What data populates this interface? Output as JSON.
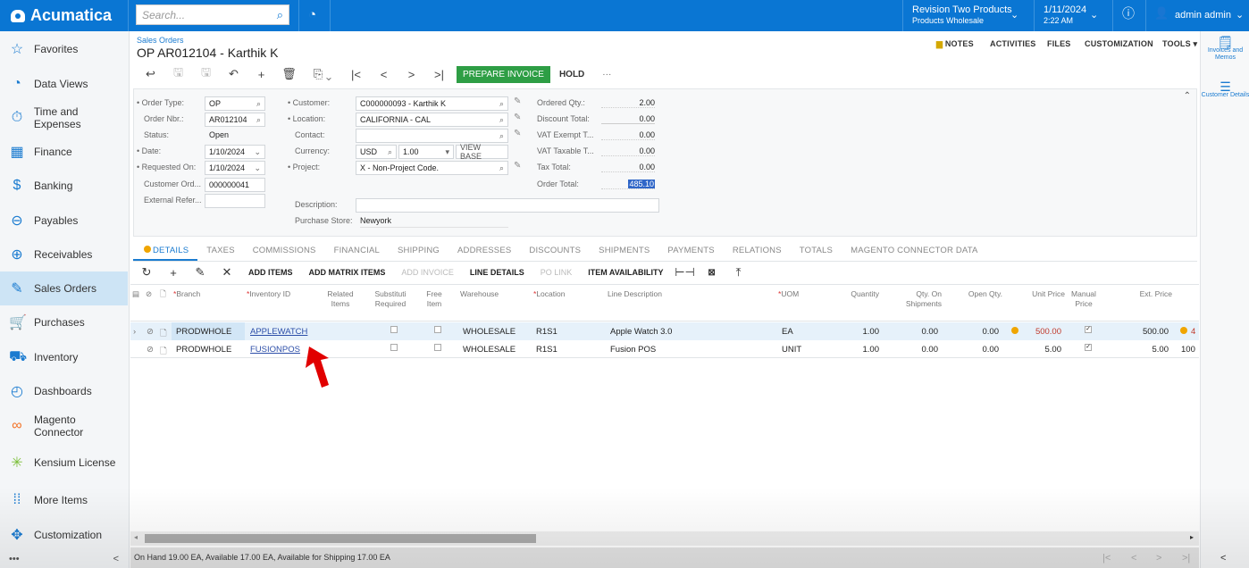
{
  "topbar": {
    "brand": "Acumatica",
    "search_placeholder": "Search...",
    "company": "Revision Two Products",
    "branch": "Products Wholesale",
    "date": "1/11/2024",
    "time": "2:22 AM",
    "user": "admin admin"
  },
  "sidebar": {
    "items": [
      {
        "label": "Favorites",
        "icon": "star-icon"
      },
      {
        "label": "Data Views",
        "icon": "pie-chart-icon"
      },
      {
        "label": "Time and Expenses",
        "icon": "stopwatch-icon"
      },
      {
        "label": "Finance",
        "icon": "calculator-icon"
      },
      {
        "label": "Banking",
        "icon": "dollar-icon"
      },
      {
        "label": "Payables",
        "icon": "minus-circle-icon"
      },
      {
        "label": "Receivables",
        "icon": "plus-circle-icon"
      },
      {
        "label": "Sales Orders",
        "icon": "edit-icon",
        "active": true
      },
      {
        "label": "Purchases",
        "icon": "cart-icon"
      },
      {
        "label": "Inventory",
        "icon": "truck-icon"
      },
      {
        "label": "Dashboards",
        "icon": "gauge-icon"
      },
      {
        "label": "Magento Connector",
        "icon": "magento-icon"
      },
      {
        "label": "Kensium License",
        "icon": "kensium-icon"
      },
      {
        "label": "More Items",
        "icon": "grid-dots-icon"
      },
      {
        "label": "Customization",
        "icon": "puzzle-icon"
      }
    ],
    "more": "•••",
    "collapse": "<"
  },
  "page": {
    "breadcrumb": "Sales Orders",
    "title": "OP AR012104 - Karthik K",
    "actions": [
      "NOTES",
      "ACTIVITIES",
      "FILES",
      "CUSTOMIZATION",
      "TOOLS ▾"
    ],
    "prepare_invoice": "PREPARE INVOICE",
    "hold": "HOLD",
    "more": "···"
  },
  "form": {
    "order_type_label": "Order Type:",
    "order_type": "OP",
    "order_nbr_label": "Order Nbr.:",
    "order_nbr": "AR012104",
    "status_label": "Status:",
    "status": "Open",
    "date_label": "Date:",
    "date": "1/10/2024",
    "requested_on_label": "Requested On:",
    "requested_on": "1/10/2024",
    "customer_ord_label": "Customer Ord...",
    "customer_ord": "000000041",
    "external_ref_label": "External Refer...",
    "external_ref": "",
    "customer_label": "Customer:",
    "customer": "C000000093 - Karthik K",
    "location_label": "Location:",
    "location": "CALIFORNIA - CAL",
    "contact_label": "Contact:",
    "contact": "",
    "currency_label": "Currency:",
    "currency": "USD",
    "rate": "1.00",
    "view_base": "VIEW BASE",
    "project_label": "Project:",
    "project": "X - Non-Project Code.",
    "description_label": "Description:",
    "description": "",
    "purchase_store_label": "Purchase Store:",
    "purchase_store": "Newyork",
    "ordered_qty_label": "Ordered Qty.:",
    "ordered_qty": "2.00",
    "discount_total_label": "Discount Total:",
    "discount_total": "0.00",
    "vat_exempt_label": "VAT Exempt T...",
    "vat_exempt": "0.00",
    "vat_taxable_label": "VAT Taxable T...",
    "vat_taxable": "0.00",
    "tax_total_label": "Tax Total:",
    "tax_total": "0.00",
    "order_total_label": "Order Total:",
    "order_total": "485.10"
  },
  "tabs": [
    "DETAILS",
    "TAXES",
    "COMMISSIONS",
    "FINANCIAL",
    "SHIPPING",
    "ADDRESSES",
    "DISCOUNTS",
    "SHIPMENTS",
    "PAYMENTS",
    "RELATIONS",
    "TOTALS",
    "MAGENTO CONNECTOR DATA"
  ],
  "grid_toolbar": {
    "add_items": "ADD ITEMS",
    "add_matrix_items": "ADD MATRIX ITEMS",
    "add_invoice": "ADD INVOICE",
    "line_details": "LINE DETAILS",
    "po_link": "PO LINK",
    "item_availability": "ITEM AVAILABILITY"
  },
  "grid": {
    "headers": {
      "branch": "Branch",
      "inventory_id": "Inventory ID",
      "related_items": "Related Items",
      "substitute": "Substituti Required",
      "free_item": "Free Item",
      "warehouse": "Warehouse",
      "location": "Location",
      "line_description": "Line Description",
      "uom": "UOM",
      "quantity": "Quantity",
      "qty_on_shipments": "Qty. On Shipments",
      "open_qty": "Open Qty.",
      "unit_price": "Unit Price",
      "manual_price": "Manual Price",
      "ext_price": "Ext. Price"
    },
    "rows": [
      {
        "branch": "PRODWHOLE",
        "inventory_id": "APPLEWATCH",
        "warehouse": "WHOLESALE",
        "location": "R1S1",
        "description": "Apple Watch 3.0",
        "uom": "EA",
        "quantity": "1.00",
        "qty_on_shipments": "0.00",
        "open_qty": "0.00",
        "unit_price": "500.00",
        "ext_price": "500.00",
        "extra": "4"
      },
      {
        "branch": "PRODWHOLE",
        "inventory_id": "FUSIONPOS",
        "warehouse": "WHOLESALE",
        "location": "R1S1",
        "description": "Fusion POS",
        "uom": "UNIT",
        "quantity": "1.00",
        "qty_on_shipments": "0.00",
        "open_qty": "0.00",
        "unit_price": "5.00",
        "ext_price": "5.00",
        "extra": "100"
      }
    ]
  },
  "status_bar": "On Hand 19.00 EA, Available 17.00 EA, Available for Shipping 17.00 EA",
  "right_panel": {
    "invoices": "Invoices and Memos",
    "customer_details": "Customer Details"
  },
  "colors": {
    "brand": "#0a76d3",
    "primary_action": "#2e9e45",
    "warning": "#f0a500",
    "annotation_arrow": "#e10000"
  }
}
